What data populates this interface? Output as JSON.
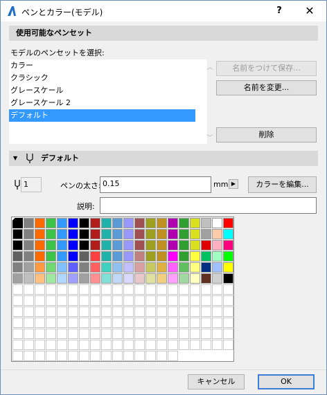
{
  "window": {
    "title": "ペンとカラー(モデル)",
    "help_label": "?",
    "close_label": "✕"
  },
  "sets_section": {
    "header": "使用可能なペンセット",
    "select_label": "モデルのペンセットを選択:",
    "items": [
      "カラー",
      "クラシック",
      "グレースケール",
      "グレースケール 2",
      "デフォルト"
    ],
    "selected_index": 4,
    "save_as_button": "名前をつけて保存...",
    "rename_button": "名前を変更...",
    "delete_button": "削除"
  },
  "pen_section": {
    "header": "デフォルト",
    "pen_number": "1",
    "thickness_label": "ペンの太さ:",
    "thickness_value": "0.15",
    "unit": "mm",
    "edit_color_button": "カラーを編集...",
    "description_label": "説明:",
    "description_value": "",
    "selected_pen_index": 0
  },
  "colors": {
    "accent": "#3399ff",
    "pen_palette_rows": [
      [
        "#000000",
        "#808080",
        "#ff6a00",
        "#3dc24a",
        "#3399ff",
        "#0000ff",
        "#000000",
        "#b01c1c",
        "#20b2aa",
        "#5b9bd5",
        "#9898ff",
        "#a05050",
        "#a0a020",
        "#c09020",
        "#b000b0",
        "#30a030",
        "#d8e020",
        "#c0c0c0",
        "#ffffff",
        "#ff0000"
      ],
      [
        "#000000",
        "#808080",
        "#ff6a00",
        "#3dc24a",
        "#3399ff",
        "#0000ff",
        "#000000",
        "#b01c1c",
        "#20b2aa",
        "#5b9bd5",
        "#9898ff",
        "#a05050",
        "#a0a020",
        "#c09020",
        "#b000b0",
        "#30a030",
        "#d8e020",
        "#a0a0a0",
        "#ffccaa",
        "#00ffff"
      ],
      [
        "#000000",
        "#808080",
        "#ff6a00",
        "#3dc24a",
        "#3399ff",
        "#0000ff",
        "#000000",
        "#b01c1c",
        "#20b2aa",
        "#5b9bd5",
        "#9898ff",
        "#a05050",
        "#a0a020",
        "#c09020",
        "#b000b0",
        "#30a030",
        "#d8e020",
        "#e00000",
        "#ffb0c0",
        "#ff007f"
      ],
      [
        "#606060",
        "#808080",
        "#ff6a00",
        "#3dc24a",
        "#3399ff",
        "#0000ff",
        "#606060",
        "#ff4040",
        "#20b2aa",
        "#5b9bd5",
        "#9898ff",
        "#c08080",
        "#a0a020",
        "#c09020",
        "#ff00ff",
        "#30a030",
        "#ffff40",
        "#00c060",
        "#a0ffc0",
        "#00ff00"
      ],
      [
        "#808080",
        "#a0a0a0",
        "#ff9a40",
        "#70d870",
        "#80c0ff",
        "#6060ff",
        "#808080",
        "#ff6060",
        "#40d0c0",
        "#90c0f0",
        "#c0c0ff",
        "#d8a0a0",
        "#c8c860",
        "#e0b040",
        "#ff60ff",
        "#60c060",
        "#ffff80",
        "#003080",
        "#a0c0ff",
        "#ffff00"
      ],
      [
        "#a0a0a0",
        "#c0c0c0",
        "#ffc080",
        "#a0e8a0",
        "#b0d8ff",
        "#a0a0ff",
        "#a0a0a0",
        "#ff9090",
        "#80e0d8",
        "#c0d8f8",
        "#d8d8ff",
        "#e8c8c8",
        "#e0e0a0",
        "#f0d080",
        "#ff a0ff",
        "#a0d8a0",
        "#ffffc0",
        "#603020",
        "#d0d0d0",
        "#000000"
      ]
    ]
  }
}
